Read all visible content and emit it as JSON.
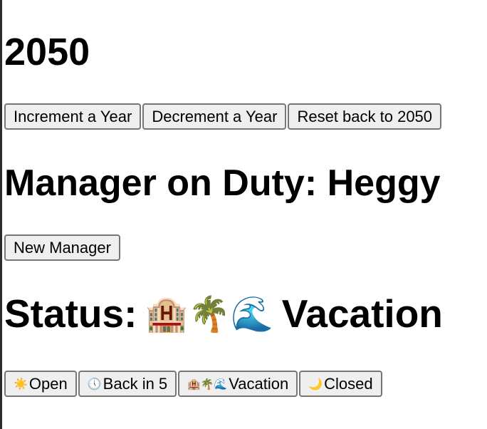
{
  "year": {
    "value": "2050"
  },
  "year_controls": {
    "increment_label": "Increment a Year",
    "decrement_label": "Decrement a Year",
    "reset_label": "Reset back to 2050"
  },
  "manager": {
    "title_prefix": "Manager on Duty:",
    "name": "Heggy",
    "new_button_label": "New Manager"
  },
  "status": {
    "title_prefix": "Status:",
    "current_icons": "🏨🌴🌊",
    "current_label": "Vacation",
    "options": [
      {
        "icon": "☀️",
        "icon_name": "sun-icon",
        "label": "Open"
      },
      {
        "icon": "🕔",
        "icon_name": "clock-icon",
        "label": "Back in 5"
      },
      {
        "icon": "🏨🌴🌊",
        "icon_name": "vacation-icons",
        "label": "Vacation"
      },
      {
        "icon": "🌙",
        "icon_name": "moon-icon",
        "label": "Closed"
      }
    ]
  }
}
